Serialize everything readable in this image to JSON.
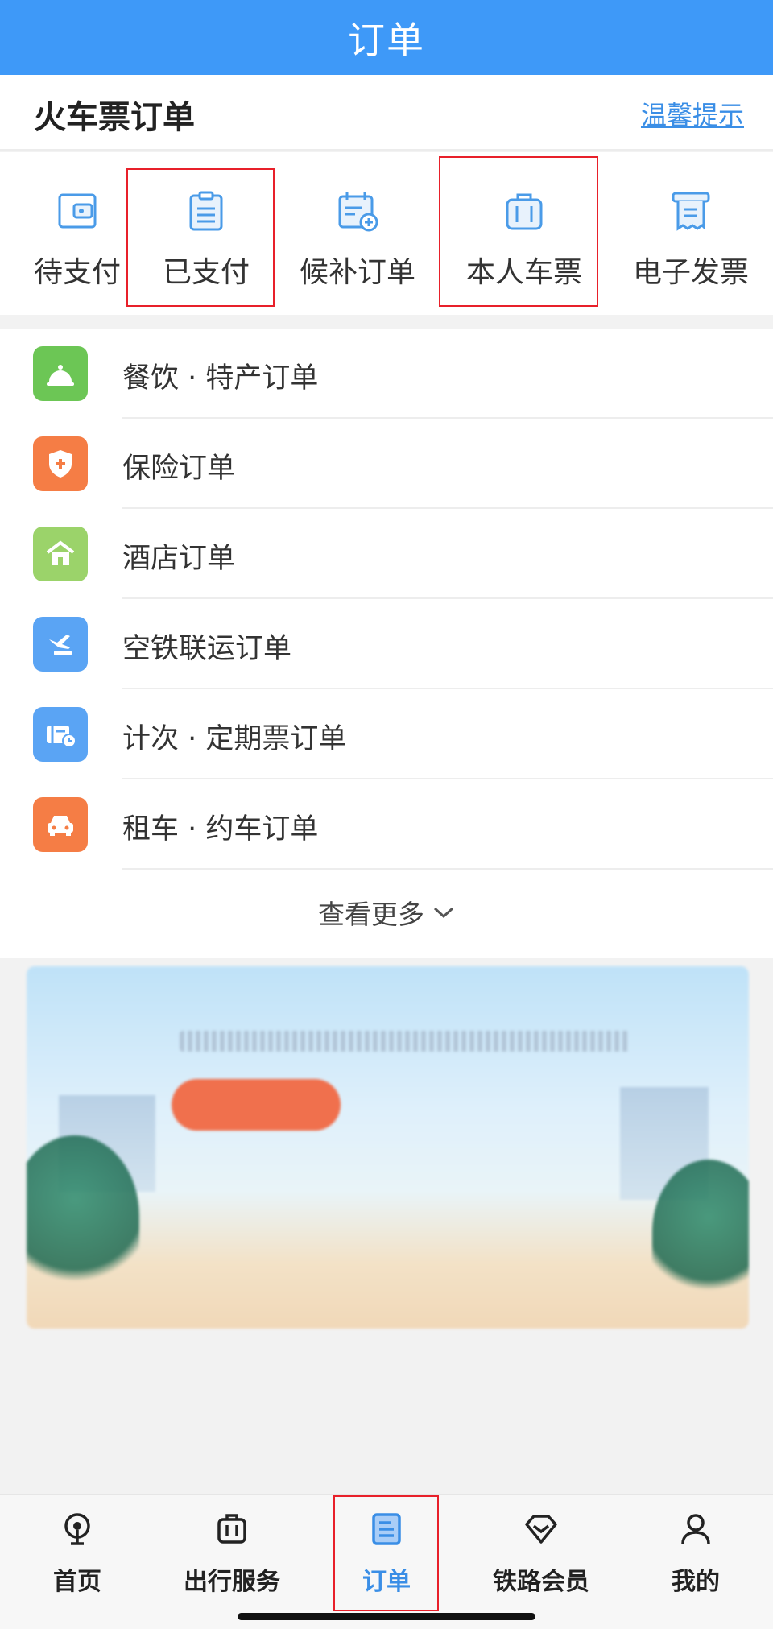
{
  "header": {
    "title": "订单"
  },
  "section": {
    "title": "火车票订单",
    "tips_link": "温馨提示"
  },
  "quick_actions": [
    {
      "label": "待支付",
      "icon": "wallet-icon",
      "highlighted": false
    },
    {
      "label": "已支付",
      "icon": "clipboard-icon",
      "highlighted": true
    },
    {
      "label": "候补订单",
      "icon": "calendar-plus-icon",
      "highlighted": false
    },
    {
      "label": "本人车票",
      "icon": "suitcase-icon",
      "highlighted": true
    },
    {
      "label": "电子发票",
      "icon": "receipt-icon",
      "highlighted": false
    }
  ],
  "order_list": [
    {
      "label": "餐饮 · 特产订单",
      "icon": "dining-bell-icon",
      "color": "#6cc655"
    },
    {
      "label": "保险订单",
      "icon": "shield-plus-icon",
      "color": "#f57d45"
    },
    {
      "label": "酒店订单",
      "icon": "hotel-icon",
      "color": "#9bd36a"
    },
    {
      "label": "空铁联运订单",
      "icon": "plane-train-icon",
      "color": "#5aa4f4"
    },
    {
      "label": "计次 · 定期票订单",
      "icon": "ticket-clock-icon",
      "color": "#5aa4f4"
    },
    {
      "label": "租车 · 约车订单",
      "icon": "car-icon",
      "color": "#f57d45"
    }
  ],
  "more": {
    "label": "查看更多"
  },
  "tabbar": {
    "items": [
      {
        "label": "首页",
        "icon": "home-train-icon",
        "active": false
      },
      {
        "label": "出行服务",
        "icon": "luggage-icon",
        "active": false
      },
      {
        "label": "订单",
        "icon": "order-doc-icon",
        "active": true
      },
      {
        "label": "铁路会员",
        "icon": "diamond-icon",
        "active": false
      },
      {
        "label": "我的",
        "icon": "person-icon",
        "active": false
      }
    ]
  },
  "colors": {
    "primary": "#3e99f8",
    "highlight": "#e8202a",
    "link": "#3a8ee6"
  }
}
